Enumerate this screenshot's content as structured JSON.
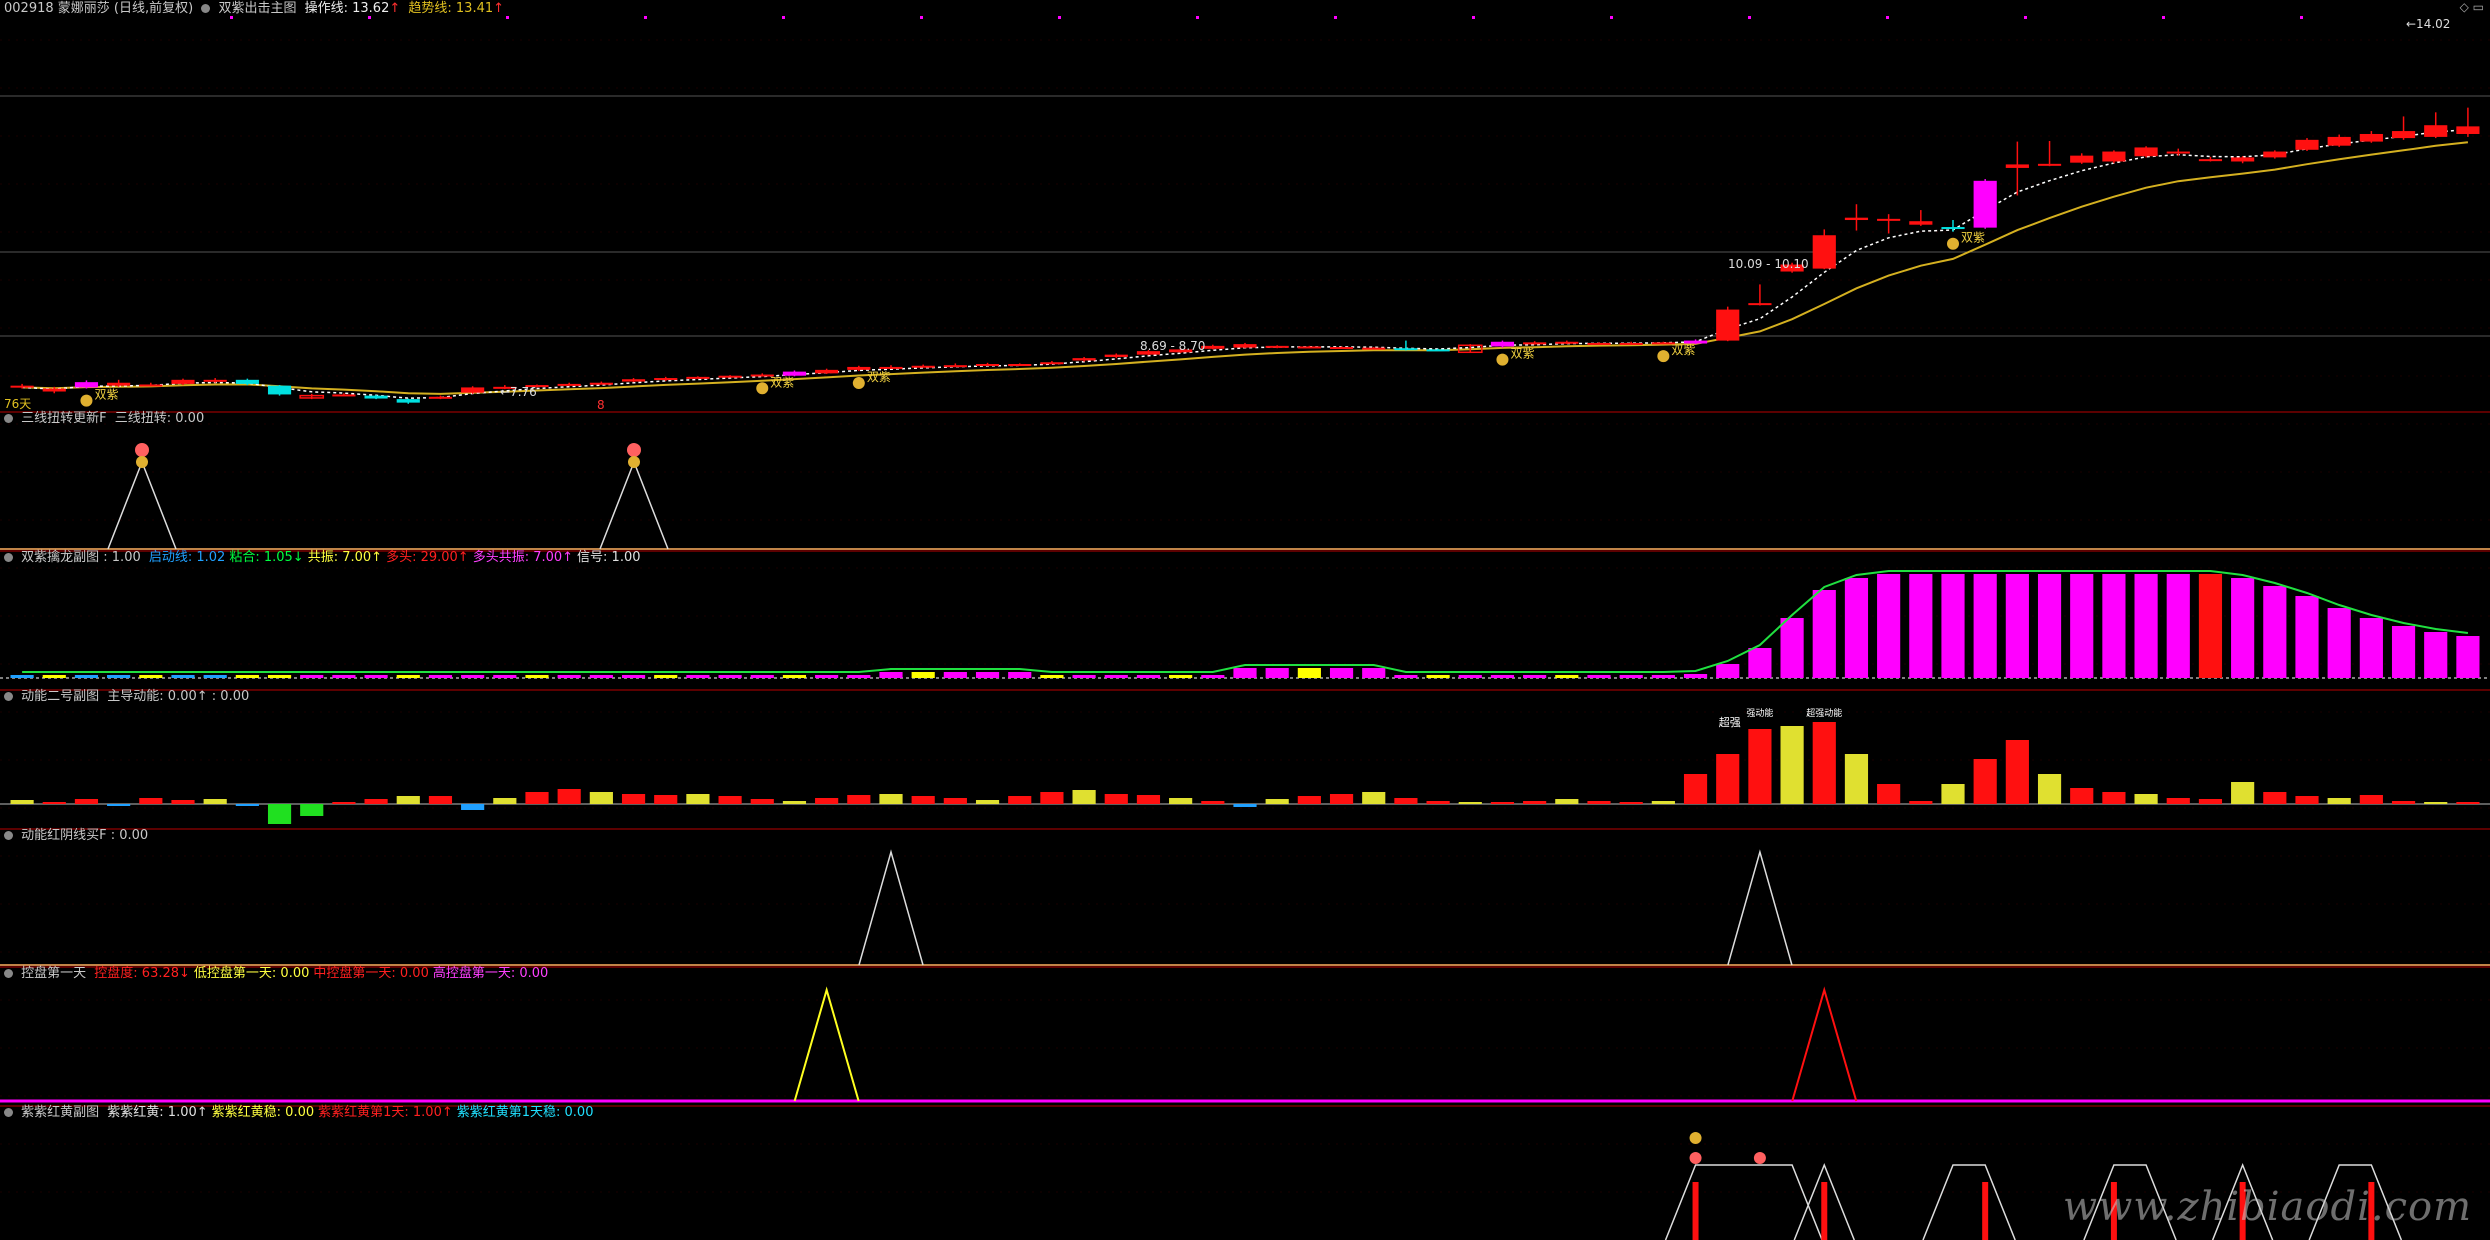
{
  "header": {
    "stock": "002918 蒙娜丽莎 (日线,前复权)",
    "indicator": "双紫出击主图",
    "op_label": "操作线: 13.62",
    "op_arrow": "↑",
    "trend_label": "趋势线: 13.41",
    "trend_arrow": "↑"
  },
  "top_right_icons": "◇ ▭",
  "main": {
    "days_label": "76天",
    "marker_8": "8",
    "price_labels": {
      "low": "←7.76",
      "mid": "8.69 - 8.70",
      "upper": "10.09 - 10.10",
      "high": "←14.02"
    },
    "signal_text": "双紫",
    "colors": {
      "up": "#ff1010",
      "down": "#00e0e0",
      "purple": "#ff00ff",
      "op_line": "#ffffff",
      "trend_line": "#d4b020"
    }
  },
  "panel1": {
    "title": "三线扭转更新F",
    "line": "三线扭转: 0.00"
  },
  "panel2": {
    "title": "双紫擒龙副图 : 1.00",
    "items": [
      {
        "label": "启动线: 1.02",
        "color": "#20a0ff"
      },
      {
        "label": "粘合: 1.05↓",
        "color": "#00ff40"
      },
      {
        "label": "共振: 7.00↑",
        "color": "#ffff40"
      },
      {
        "label": "多头: 29.00↑",
        "color": "#ff2020"
      },
      {
        "label": "多头共振: 7.00↑",
        "color": "#ff40ff"
      },
      {
        "label": "信号: 1.00",
        "color": "#e0e0e0"
      }
    ]
  },
  "panel3": {
    "title": "动能二号副图",
    "line": "主导动能: 0.00↑ : 0.00",
    "annots": [
      "超强",
      "强动能",
      "超强动能"
    ]
  },
  "panel4": {
    "title": "动能红阴线买F : 0.00"
  },
  "panel5": {
    "title": "控盘第一天",
    "items": [
      {
        "label": "控盘度: 63.28↓",
        "color": "#ff2020"
      },
      {
        "label": "低控盘第一天: 0.00",
        "color": "#ffff40"
      },
      {
        "label": "中控盘第一天: 0.00",
        "color": "#ff2020"
      },
      {
        "label": "高控盘第一天: 0.00",
        "color": "#ff40ff"
      }
    ]
  },
  "panel6": {
    "title": "紫紫红黄副图",
    "items": [
      {
        "label": "紫紫红黄: 1.00↑",
        "color": "#e0e0e0"
      },
      {
        "label": "紫紫红黄稳: 0.00",
        "color": "#ffff40"
      },
      {
        "label": "紫紫红黄第1天: 1.00↑",
        "color": "#ff2020"
      },
      {
        "label": "紫紫红黄第1天稳: 0.00",
        "color": "#20e0ff"
      }
    ]
  },
  "watermark": "www.zhibiaodi.com",
  "chart_data": {
    "type": "candlestick",
    "ylim": [
      7.5,
      14.3
    ],
    "candles": [
      [
        7.95,
        7.92,
        7.98,
        7.9,
        "r"
      ],
      [
        7.9,
        7.85,
        7.93,
        7.82,
        "r"
      ],
      [
        7.92,
        8.01,
        8.04,
        7.9,
        "p"
      ],
      [
        8.0,
        7.95,
        8.05,
        7.93,
        "r"
      ],
      [
        7.95,
        7.97,
        8.0,
        7.94,
        "r"
      ],
      [
        7.98,
        8.05,
        8.07,
        7.96,
        "r"
      ],
      [
        8.05,
        8.02,
        8.08,
        8.0,
        "r"
      ],
      [
        8.05,
        7.98,
        8.07,
        7.96,
        "c"
      ],
      [
        7.95,
        7.8,
        7.96,
        7.78,
        "c"
      ],
      [
        7.78,
        7.74,
        7.81,
        7.72,
        "o"
      ],
      [
        7.8,
        7.79,
        7.82,
        7.78,
        "r"
      ],
      [
        7.78,
        7.73,
        7.79,
        7.72,
        "c"
      ],
      [
        7.72,
        7.66,
        7.73,
        7.64,
        "c"
      ],
      [
        7.74,
        7.76,
        7.78,
        7.72,
        "r"
      ],
      [
        7.83,
        7.92,
        7.94,
        7.81,
        "r"
      ],
      [
        7.9,
        7.93,
        7.96,
        7.89,
        "r"
      ],
      [
        7.94,
        7.96,
        7.97,
        7.92,
        "r"
      ],
      [
        7.96,
        7.98,
        8.0,
        7.95,
        "r"
      ],
      [
        7.98,
        8.0,
        8.02,
        7.97,
        "r"
      ],
      [
        8.02,
        8.06,
        8.08,
        8.01,
        "r"
      ],
      [
        8.05,
        8.08,
        8.1,
        8.03,
        "r"
      ],
      [
        8.1,
        8.09,
        8.11,
        8.08,
        "r"
      ],
      [
        8.11,
        8.12,
        8.13,
        8.1,
        "r"
      ],
      [
        8.12,
        8.14,
        8.16,
        8.11,
        "r"
      ],
      [
        8.12,
        8.19,
        8.21,
        8.11,
        "p"
      ],
      [
        8.16,
        8.22,
        8.24,
        8.15,
        "r"
      ],
      [
        8.22,
        8.27,
        8.29,
        8.2,
        "r"
      ],
      [
        8.27,
        8.26,
        8.3,
        8.25,
        "r"
      ],
      [
        8.28,
        8.29,
        8.31,
        8.27,
        "r"
      ],
      [
        8.3,
        8.3,
        8.33,
        8.29,
        "r"
      ],
      [
        8.32,
        8.31,
        8.34,
        8.3,
        "r"
      ],
      [
        8.32,
        8.31,
        8.33,
        8.3,
        "r"
      ],
      [
        8.33,
        8.35,
        8.37,
        8.32,
        "r"
      ],
      [
        8.38,
        8.42,
        8.44,
        8.36,
        "r"
      ],
      [
        8.44,
        8.48,
        8.5,
        8.42,
        "r"
      ],
      [
        8.48,
        8.54,
        8.56,
        8.47,
        "r"
      ],
      [
        8.52,
        8.57,
        8.59,
        8.51,
        "r"
      ],
      [
        8.58,
        8.63,
        8.65,
        8.57,
        "r"
      ],
      [
        8.6,
        8.66,
        8.68,
        8.59,
        "r"
      ],
      [
        8.6,
        8.63,
        8.64,
        8.59,
        "r"
      ],
      [
        8.6,
        8.62,
        8.63,
        8.59,
        "r"
      ],
      [
        8.6,
        8.61,
        8.62,
        8.59,
        "r"
      ],
      [
        8.59,
        8.6,
        8.61,
        8.58,
        "r"
      ],
      [
        8.59,
        8.56,
        8.72,
        8.55,
        "c"
      ],
      [
        8.57,
        8.56,
        8.58,
        8.55,
        "c"
      ],
      [
        8.52,
        8.64,
        8.66,
        8.51,
        "o"
      ],
      [
        8.62,
        8.7,
        8.72,
        8.6,
        "p"
      ],
      [
        8.69,
        8.66,
        8.71,
        8.65,
        "r"
      ],
      [
        8.67,
        8.7,
        8.72,
        8.66,
        "r"
      ],
      [
        8.68,
        8.68,
        8.69,
        8.67,
        "r"
      ],
      [
        8.68,
        8.68,
        8.7,
        8.67,
        "r"
      ],
      [
        8.67,
        8.69,
        8.7,
        8.66,
        "r"
      ],
      [
        8.67,
        8.72,
        8.74,
        8.66,
        "p"
      ],
      [
        8.72,
        9.25,
        9.3,
        8.71,
        "r"
      ],
      [
        9.34,
        9.36,
        9.68,
        9.32,
        "r"
      ],
      [
        9.9,
        10.02,
        10.05,
        9.88,
        "r"
      ],
      [
        9.95,
        10.52,
        10.62,
        9.94,
        "r"
      ],
      [
        10.78,
        10.82,
        11.05,
        10.6,
        "r"
      ],
      [
        10.8,
        10.8,
        10.88,
        10.55,
        "r"
      ],
      [
        10.7,
        10.76,
        10.95,
        10.68,
        "r"
      ],
      [
        10.66,
        10.64,
        10.78,
        10.58,
        "c"
      ],
      [
        10.65,
        11.45,
        11.48,
        10.63,
        "p"
      ],
      [
        11.67,
        11.73,
        12.12,
        11.2,
        "r"
      ],
      [
        11.72,
        11.74,
        12.13,
        11.7,
        "r"
      ],
      [
        11.76,
        11.88,
        11.92,
        11.74,
        "r"
      ],
      [
        11.78,
        11.95,
        11.97,
        11.75,
        "r"
      ],
      [
        11.87,
        12.02,
        12.04,
        11.85,
        "r"
      ],
      [
        11.95,
        11.95,
        12.0,
        11.88,
        "r"
      ],
      [
        11.8,
        11.82,
        11.86,
        11.78,
        "r"
      ],
      [
        11.78,
        11.85,
        11.87,
        11.75,
        "r"
      ],
      [
        11.85,
        11.95,
        11.97,
        11.83,
        "r"
      ],
      [
        11.98,
        12.15,
        12.18,
        11.96,
        "r"
      ],
      [
        12.05,
        12.2,
        12.24,
        12.03,
        "r"
      ],
      [
        12.12,
        12.25,
        12.3,
        12.1,
        "r"
      ],
      [
        12.18,
        12.3,
        12.55,
        12.15,
        "r"
      ],
      [
        12.2,
        12.4,
        12.62,
        12.18,
        "r"
      ],
      [
        12.25,
        12.38,
        12.7,
        12.2,
        "r"
      ]
    ]
  }
}
